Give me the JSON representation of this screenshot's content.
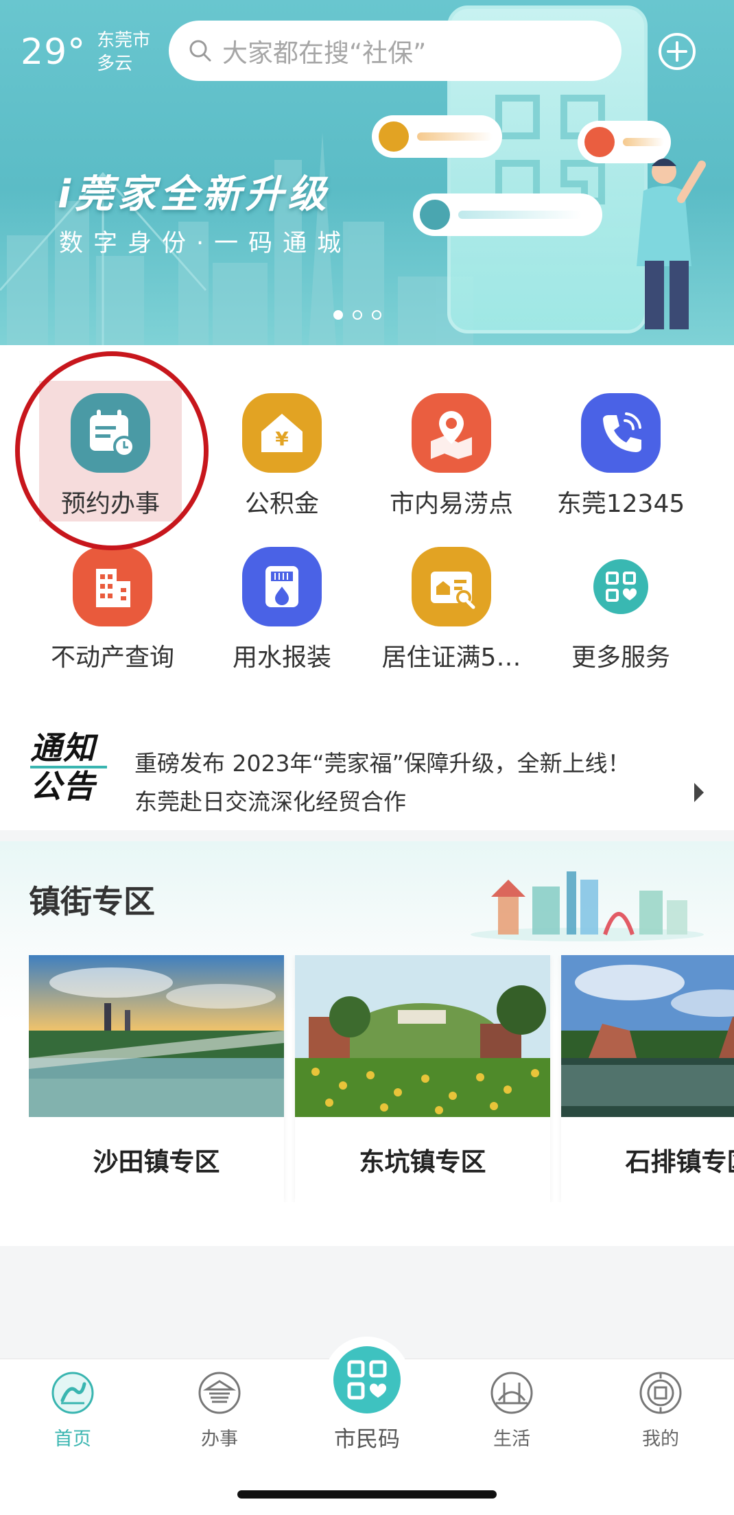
{
  "header": {
    "temperature": "29°",
    "city": "东莞市",
    "weather": "多云",
    "search_placeholder": "大家都在搜“社保”"
  },
  "banner": {
    "title": "i莞家全新升级",
    "subtitle": "数字身份·一码通城",
    "slide_count": 3,
    "active_slide": 1
  },
  "services": [
    {
      "label": "预约办事",
      "icon": "calendar-icon",
      "color": "#4a9aa5",
      "highlighted": true
    },
    {
      "label": "公积金",
      "icon": "house-yen-icon",
      "color": "#e2a323"
    },
    {
      "label": "市内易涝点",
      "icon": "map-pin-icon",
      "color": "#ea5e40"
    },
    {
      "label": "东莞12345",
      "icon": "phone-icon",
      "color": "#4a62e6"
    },
    {
      "label": "不动产查询",
      "icon": "building-icon",
      "color": "#e95a3c"
    },
    {
      "label": "用水报装",
      "icon": "water-meter-icon",
      "color": "#4a62e6"
    },
    {
      "label": "居住证满5…",
      "icon": "id-card-icon",
      "color": "#e2a323"
    },
    {
      "label": "更多服务",
      "icon": "grid-heart-icon",
      "color": "#39b8b2"
    }
  ],
  "notice": {
    "logo_text_top": "通知",
    "logo_text_bottom": "公告",
    "line1": "重磅发布 2023年“莞家福”保障升级，全新上线！",
    "line2": "东莞赴日交流深化经贸合作"
  },
  "zone": {
    "title": "镇街专区",
    "cards": [
      {
        "label": "沙田镇专区"
      },
      {
        "label": "东坑镇专区"
      },
      {
        "label": "石排镇专区"
      }
    ]
  },
  "tabbar": {
    "tabs": [
      {
        "label": "首页",
        "icon": "home-icon",
        "active": true
      },
      {
        "label": "办事",
        "icon": "pavilion-icon",
        "active": false
      },
      {
        "label": "市民码",
        "icon": "qr-code-icon",
        "active": false
      },
      {
        "label": "生活",
        "icon": "bridge-icon",
        "active": false
      },
      {
        "label": "我的",
        "icon": "profile-icon",
        "active": false
      }
    ]
  },
  "colors": {
    "accent": "#39b5b0",
    "highlight_circle": "#c7161c",
    "highlight_fill": "#f6dcdc"
  }
}
